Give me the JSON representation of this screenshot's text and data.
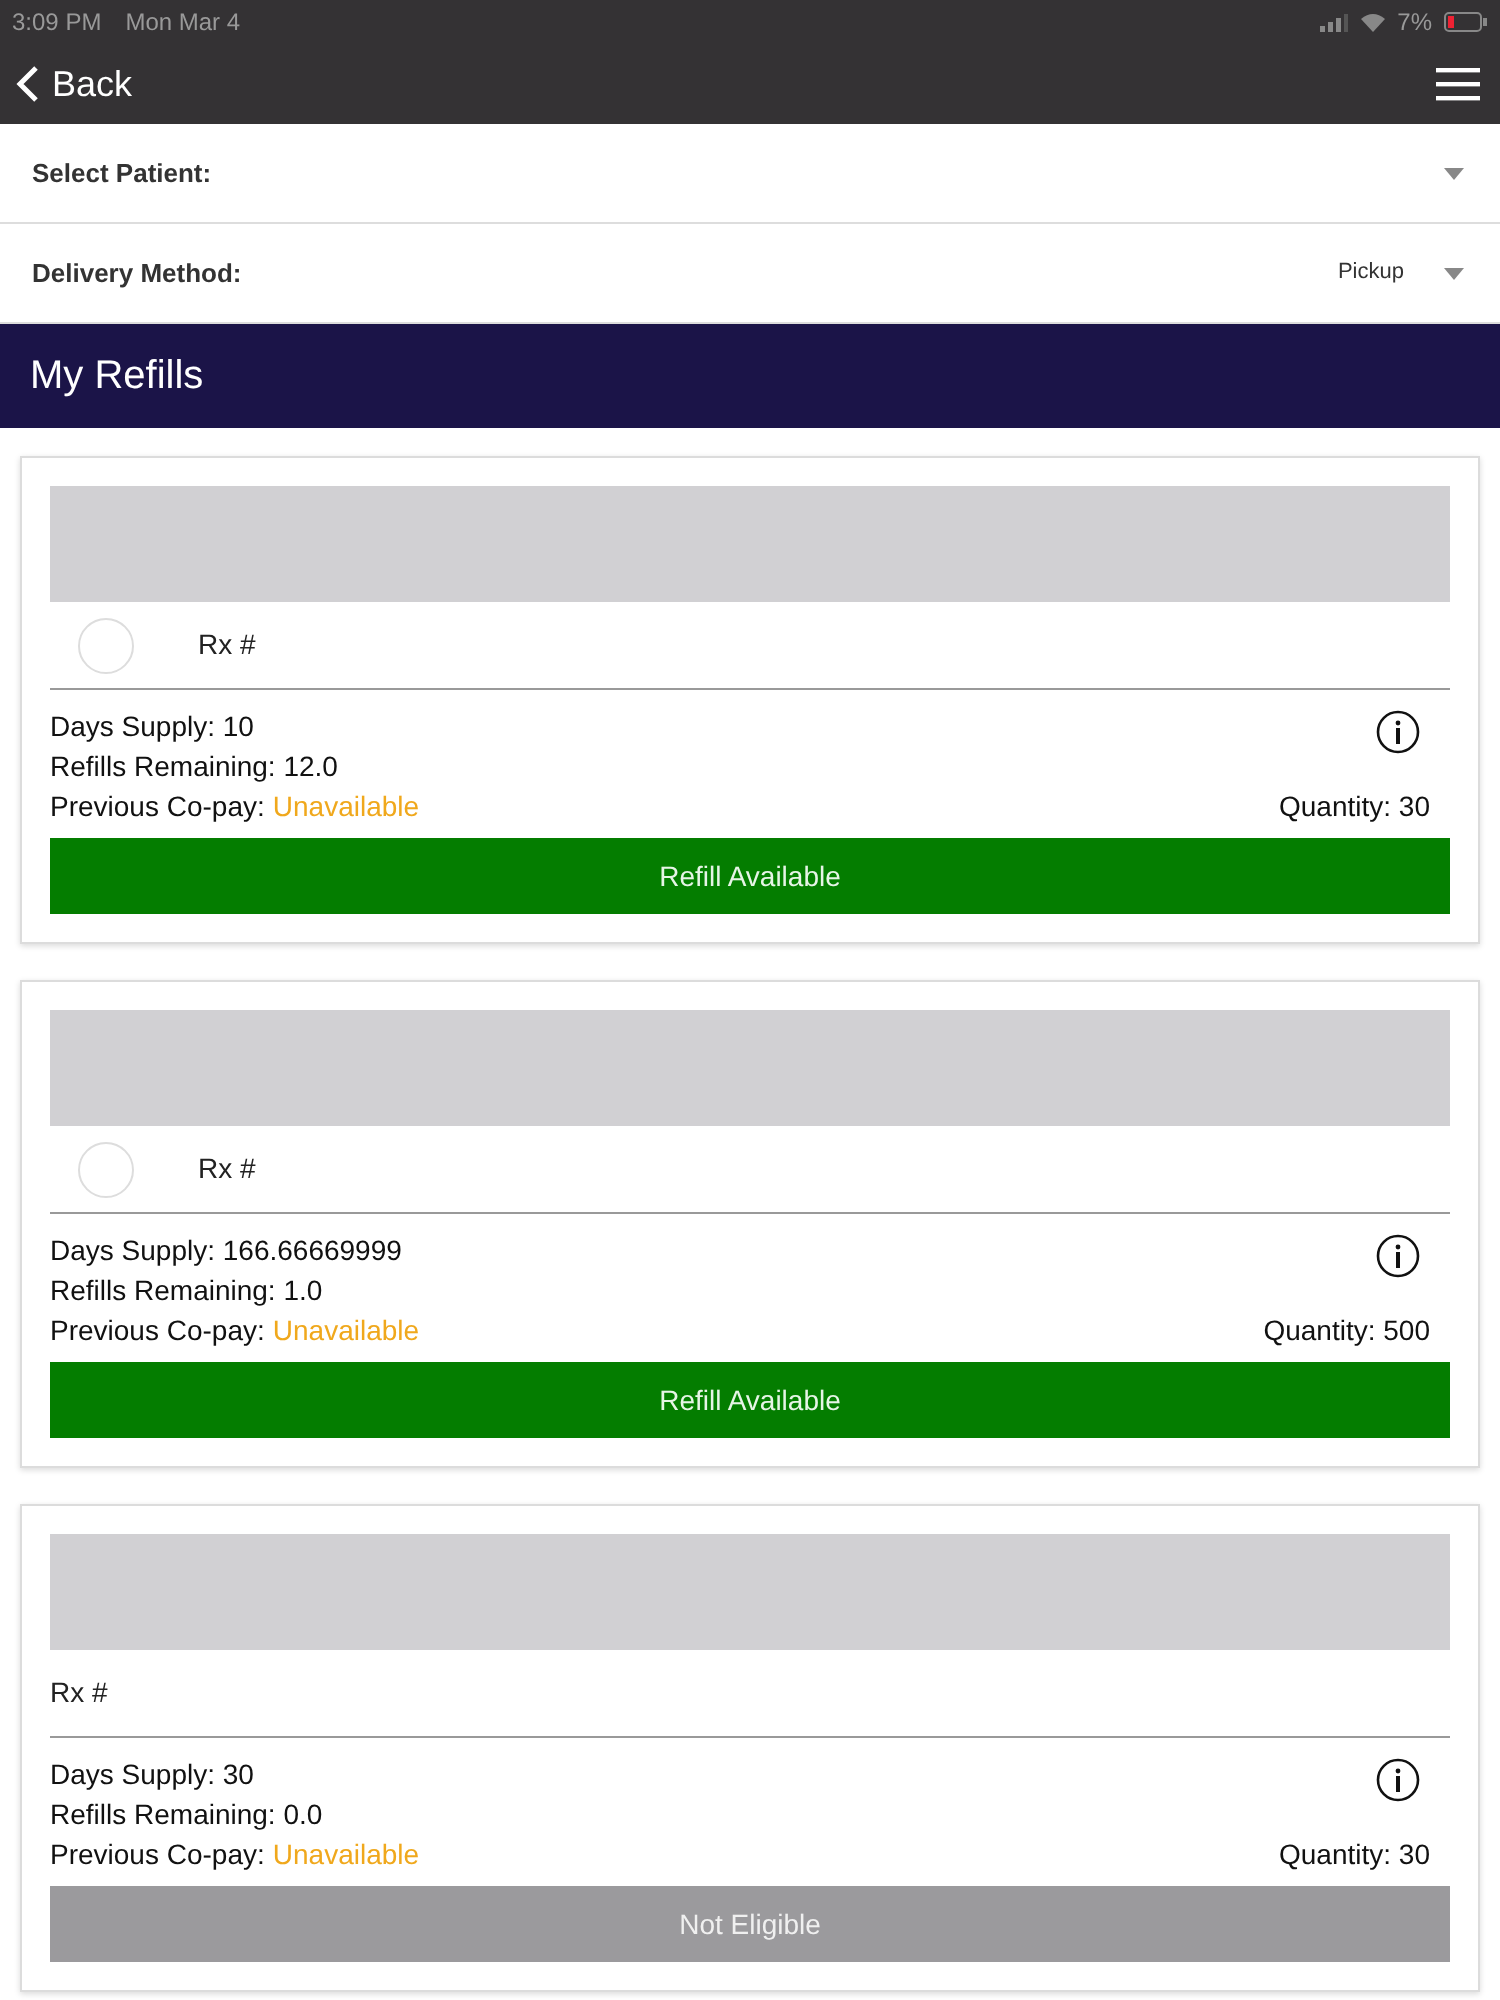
{
  "status_bar": {
    "time": "3:09 PM",
    "date": "Mon Mar 4",
    "battery": "7%"
  },
  "nav": {
    "back": "Back"
  },
  "fields": [
    {
      "label": "Select Patient:"
    },
    {
      "label": "Delivery Method:",
      "value": "Pickup"
    }
  ],
  "section_title": "My Refills",
  "refills": [
    {
      "selectable": true,
      "checked": false,
      "rx": "Rx #",
      "days_supply": "Days Supply: 10",
      "refills_remaining": "Refills Remaining: 12.0",
      "copay_label": "Previous Co-pay:",
      "copay": "Unavailable",
      "quantity": "Quantity: 30",
      "action": {
        "label": "Refill Available",
        "eligible": true
      }
    },
    {
      "selectable": true,
      "checked": false,
      "rx": "Rx #",
      "days_supply": "Days Supply: 166.66669999",
      "refills_remaining": "Refills Remaining: 1.0",
      "copay_label": "Previous Co-pay:",
      "copay": "Unavailable",
      "quantity": "Quantity: 500",
      "action": {
        "label": "Refill Available",
        "eligible": true
      }
    },
    {
      "selectable": false,
      "rx": "Rx #",
      "days_supply": "Days Supply: 30",
      "refills_remaining": "Refills Remaining: 0.0",
      "copay_label": "Previous Co-pay:",
      "copay": "Unavailable",
      "quantity": "Quantity: 30",
      "action": {
        "label": "Not Eligible",
        "eligible": false
      }
    }
  ]
}
